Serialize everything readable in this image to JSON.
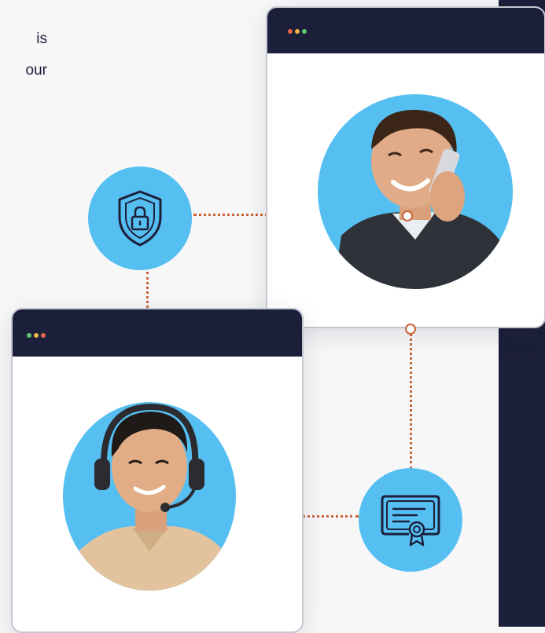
{
  "intro": {
    "text_line1": "is",
    "text_line2": "our"
  },
  "window_top": {
    "dots": [
      "#e7654b",
      "#f2b441",
      "#5ec76e"
    ],
    "avatar_icon": "man-on-phone-avatar"
  },
  "window_bottom": {
    "dots": [
      "#5ec76e",
      "#f2b441",
      "#e7654b"
    ],
    "avatar_icon": "man-with-headset-avatar"
  },
  "badges": {
    "security": "shield-lock-icon",
    "certificate": "certificate-icon"
  },
  "colors": {
    "dark": "#1c1f3a",
    "accent_blue": "#56bff1",
    "connector": "#c9643a"
  }
}
